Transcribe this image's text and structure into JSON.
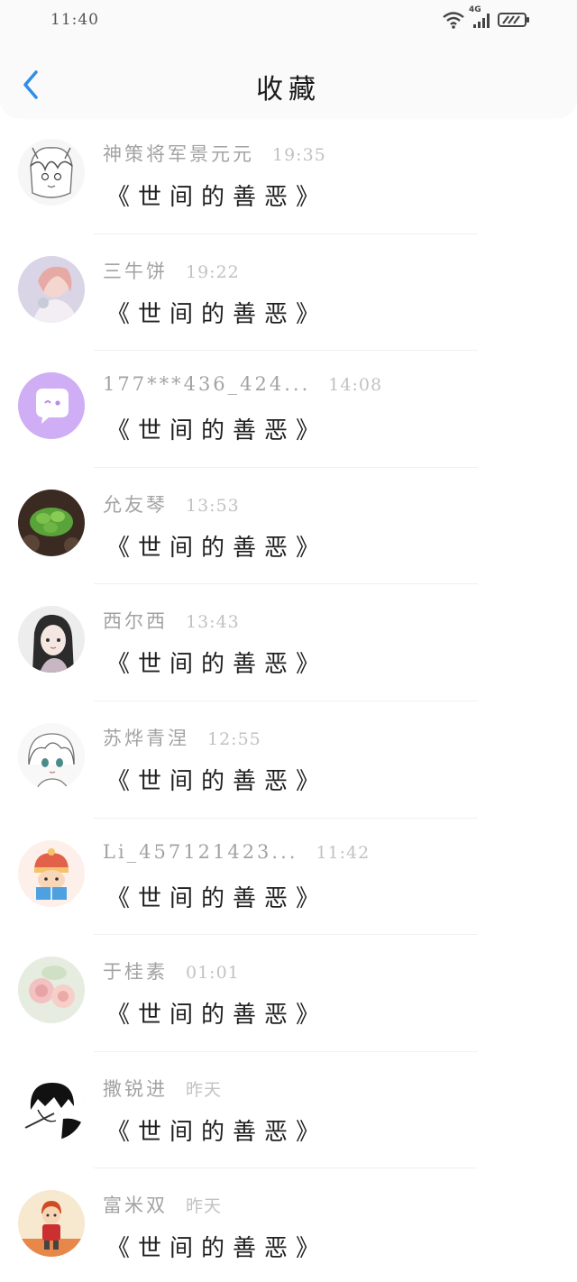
{
  "status": {
    "time": "11:40",
    "network": "4G"
  },
  "header": {
    "title": "收藏"
  },
  "book_title": "《世间的善恶》",
  "items": [
    {
      "name": "神策将军景元元",
      "time": "19:35",
      "avatar": "sketch-anime-boy"
    },
    {
      "name": "三牛饼",
      "time": "19:22",
      "avatar": "anime-girl-pink"
    },
    {
      "name": "177***436_424...",
      "time": "14:08",
      "avatar": "default-chat-purple"
    },
    {
      "name": "允友琴",
      "time": "13:53",
      "avatar": "succulent-plant"
    },
    {
      "name": "西尔西",
      "time": "13:43",
      "avatar": "anime-girl-dark-hair"
    },
    {
      "name": "苏烨青涅",
      "time": "12:55",
      "avatar": "sketch-anime-girl"
    },
    {
      "name": "Li_457121423...",
      "time": "11:42",
      "avatar": "cartoon-kid-reading"
    },
    {
      "name": "于桂素",
      "time": "01:01",
      "avatar": "pink-roses"
    },
    {
      "name": "撒锐进",
      "time": "昨天",
      "avatar": "manga-sketch"
    },
    {
      "name": "富米双",
      "time": "昨天",
      "avatar": "cartoon-kid-red"
    }
  ],
  "colors": {
    "accent": "#2f8ee8",
    "name": "#a3a3a3",
    "time": "#c2c2c2"
  }
}
